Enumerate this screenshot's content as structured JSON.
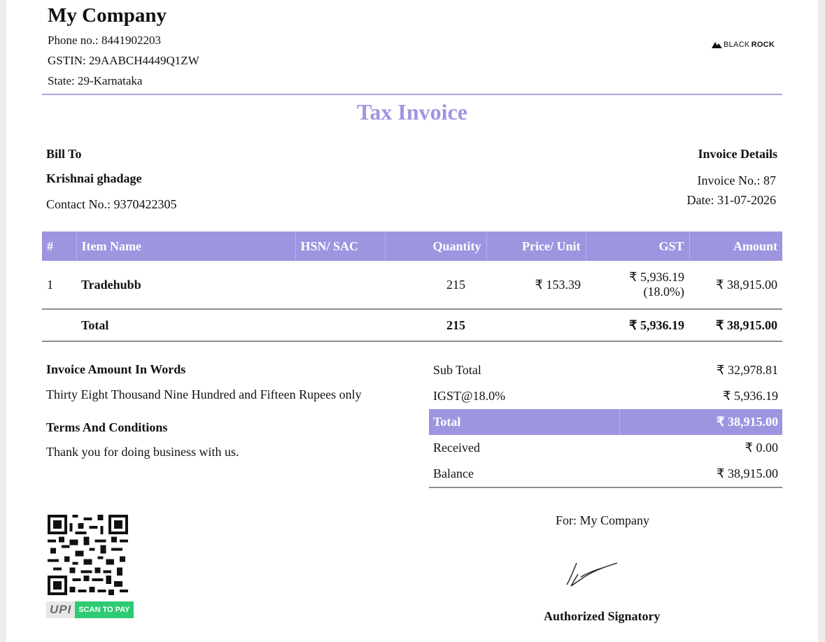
{
  "company": {
    "name": "My Company",
    "phone": "Phone no.: 8441902203",
    "gstin": "GSTIN: 29AABCH4449Q1ZW",
    "state": "State: 29-Karnataka",
    "logo_prefix": "BLACK",
    "logo_suffix": "ROCK"
  },
  "title": "Tax Invoice",
  "bill_to": {
    "heading": "Bill To",
    "name": "Krishnai ghadage",
    "contact": "Contact No.: 9370422305"
  },
  "invoice_details": {
    "heading": "Invoice Details",
    "number": "Invoice No.: 87",
    "date": "Date: 31-07-2026"
  },
  "items_table": {
    "headers": [
      "#",
      "Item Name",
      "HSN/ SAC",
      "Quantity",
      "Price/ Unit",
      "GST",
      "Amount"
    ],
    "rows": [
      {
        "index": "1",
        "name": "Tradehubb",
        "hsn": "",
        "quantity": "215",
        "price": "₹ 153.39",
        "gst": "₹ 5,936.19",
        "gst_rate": "(18.0%)",
        "amount": "₹ 38,915.00"
      }
    ],
    "total": {
      "label": "Total",
      "quantity": "215",
      "gst": "₹ 5,936.19",
      "amount": "₹ 38,915.00"
    }
  },
  "amount_in_words": {
    "heading": "Invoice Amount In Words",
    "text": "Thirty Eight Thousand Nine Hundred and Fifteen Rupees only"
  },
  "terms": {
    "heading": "Terms And Conditions",
    "text": "Thank you for doing business with us."
  },
  "summary": {
    "sub_total_label": "Sub Total",
    "sub_total": "₹ 32,978.81",
    "igst_label": "IGST@18.0%",
    "igst": "₹ 5,936.19",
    "total_label": "Total",
    "total": "₹ 38,915.00",
    "received_label": "Received",
    "received": "₹ 0.00",
    "balance_label": "Balance",
    "balance": "₹ 38,915.00"
  },
  "signature": {
    "for_label": "For: My Company",
    "signatory": "Authorized Signatory"
  },
  "payment": {
    "upi_label": "UPI",
    "scan_label": "SCAN TO PAY"
  },
  "colors": {
    "accent": "#9d95e0",
    "title": "#9e96e2",
    "upi_green": "#2ecb73"
  }
}
